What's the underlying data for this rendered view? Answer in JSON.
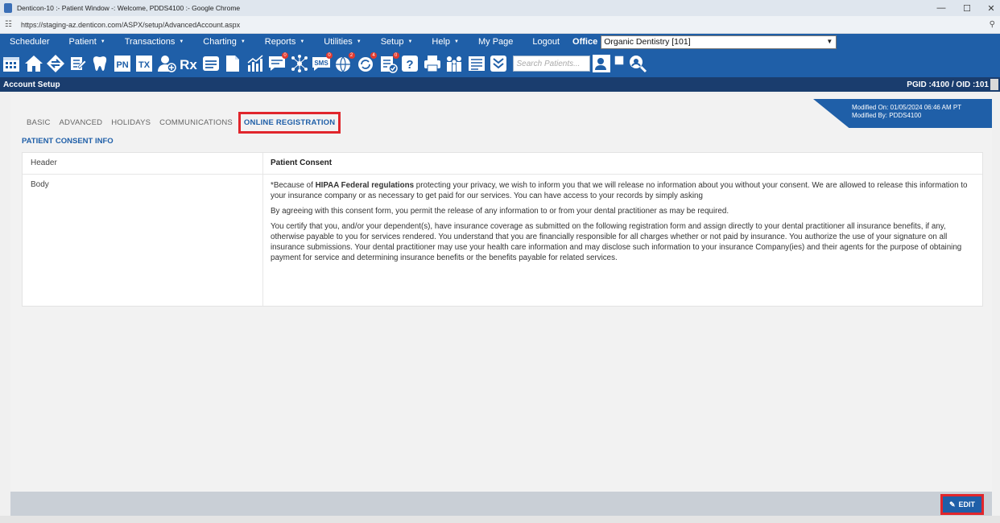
{
  "window": {
    "title": "Denticon-10 :- Patient Window -: Welcome, PDDS4100 :- Google Chrome",
    "url": "https://staging-az.denticon.com/ASPX/setup/AdvancedAccount.aspx",
    "min": "—",
    "max": "☐",
    "close": "✕"
  },
  "menu": {
    "items": [
      {
        "label": "Scheduler",
        "caret": false
      },
      {
        "label": "Patient",
        "caret": true
      },
      {
        "label": "Transactions",
        "caret": true
      },
      {
        "label": "Charting",
        "caret": true
      },
      {
        "label": "Reports",
        "caret": true
      },
      {
        "label": "Utilities",
        "caret": true
      },
      {
        "label": "Setup",
        "caret": true
      },
      {
        "label": "Help",
        "caret": true
      },
      {
        "label": "My Page",
        "caret": false
      },
      {
        "label": "Logout",
        "caret": false
      }
    ],
    "office_label": "Office",
    "office_value": "Organic Dentistry [101]"
  },
  "toolbar": {
    "search_placeholder": "Search Patients...",
    "badges": {
      "messages": "0",
      "sms": "0",
      "globe": "2",
      "sync": "4",
      "clipboard": "0"
    },
    "text_icons": {
      "pn": "PN",
      "tx": "TX",
      "rx": "Rx",
      "sms": "SMS"
    }
  },
  "page": {
    "title": "Account Setup",
    "pgid": "PGID :4100 / OID :101"
  },
  "tabs": [
    "BASIC",
    "ADVANCED",
    "HOLIDAYS",
    "COMMUNICATIONS",
    "ONLINE REGISTRATION"
  ],
  "modified": {
    "on": "Modified On: 01/05/2024 06:46 AM PT",
    "by": "Modified By: PDDS4100"
  },
  "section_title": "PATIENT CONSENT INFO",
  "consent": {
    "header_label": "Header",
    "header_value": "Patient Consent",
    "body_label": "Body",
    "p1_pre": "*Because of ",
    "p1_bold": "HIPAA Federal regulations",
    "p1_post": " protecting your privacy, we wish to inform you that we will release no information about you without your consent. We are allowed to release this information to your insurance company or as necessary to get paid for our services. You can have access to your records by simply asking",
    "p2": "By agreeing with this consent form, you permit the release of any information to or from your dental practitioner as may be required.",
    "p3": "You certify that you, and/or your dependent(s), have insurance coverage as submitted on the following registration form and assign directly to your dental practitioner all insurance benefits, if any, otherwise payable to you for services rendered. You understand that you are financially responsible for all charges whether or not paid by insurance. You authorize the use of your signature on all insurance submissions. Your dental practitioner may use your health care information and may disclose such information to your insurance Company(ies) and their agents for the purpose of obtaining payment for service and determining insurance benefits or the benefits payable for related services."
  },
  "actions": {
    "edit_label": "EDIT"
  },
  "colors": {
    "brand": "#1f5fa8",
    "dark": "#1a3d6e",
    "highlight": "#e0262c"
  }
}
